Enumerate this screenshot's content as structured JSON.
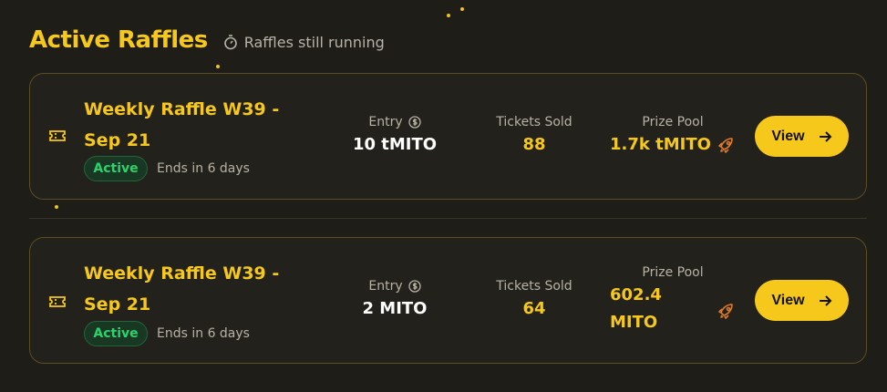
{
  "header": {
    "title": "Active Raffles",
    "subtitle": "Raffles still running",
    "subtitle_icon": "stopwatch-icon"
  },
  "labels": {
    "entry": "Entry",
    "tickets_sold": "Tickets Sold",
    "prize_pool": "Prize Pool",
    "view": "View"
  },
  "raffles": [
    {
      "name": "Weekly Raffle W39 - Sep 21",
      "status": "Active",
      "ends": "Ends in 6 days",
      "entry": "10 tMITO",
      "tickets_sold": "88",
      "prize_pool_line1": "1.7k tMITO",
      "prize_pool_line2": ""
    },
    {
      "name": "Weekly Raffle W39 - Sep 21",
      "status": "Active",
      "ends": "Ends in 6 days",
      "entry": "2 MITO",
      "tickets_sold": "64",
      "prize_pool_line1": "602.4",
      "prize_pool_line2": "MITO"
    }
  ],
  "colors": {
    "accent": "#f6c81c",
    "background": "#1f1d18",
    "active_green": "#2ed16b",
    "rocket": "#e07b2a"
  }
}
